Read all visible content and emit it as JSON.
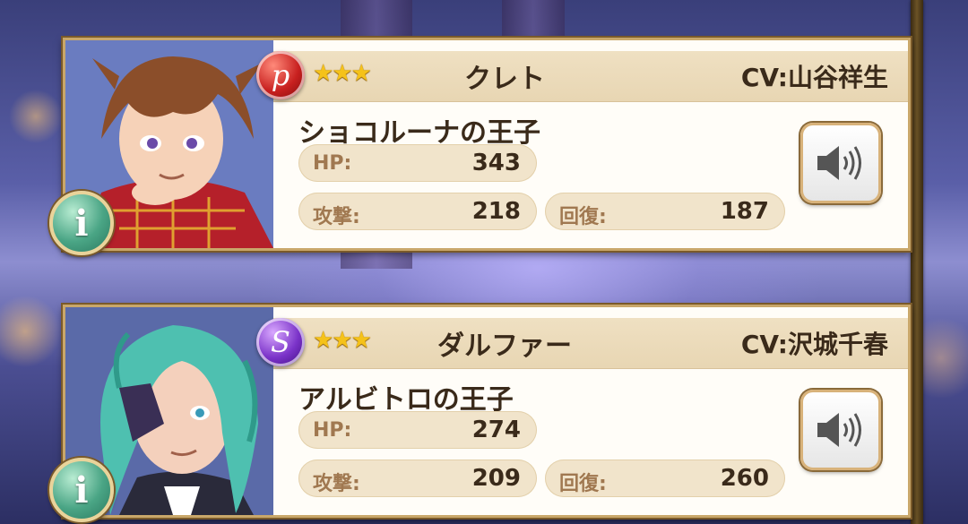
{
  "characters": [
    {
      "element": "p",
      "element_color": "#c8201f",
      "stars": "★★★",
      "name": "クレト",
      "cv": "CV:山谷祥生",
      "title": "ショコルーナの王子",
      "hp_label": "HP:",
      "hp": "343",
      "atk_label": "攻撃:",
      "atk": "218",
      "heal_label": "回復:",
      "heal": "187",
      "info_label": "i"
    },
    {
      "element": "S",
      "element_color": "#7a32c8",
      "stars": "★★★",
      "name": "ダルファー",
      "cv": "CV:沢城千春",
      "title": "アルビトロの王子",
      "hp_label": "HP:",
      "hp": "274",
      "atk_label": "攻撃:",
      "atk": "209",
      "heal_label": "回復:",
      "heal": "260",
      "info_label": "i"
    }
  ],
  "icons": {
    "voice": "speaker-icon",
    "info": "info-icon"
  }
}
